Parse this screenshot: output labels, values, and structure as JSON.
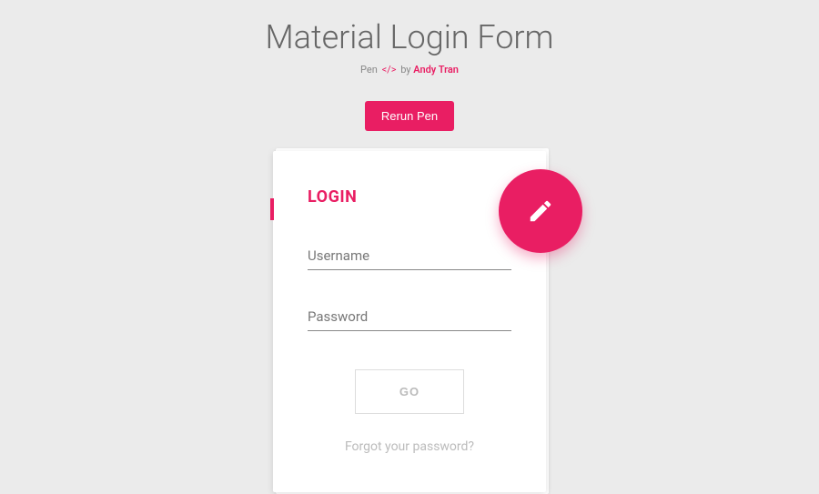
{
  "header": {
    "title": "Material Login Form",
    "subtitle_prefix": "Pen",
    "subtitle_middle": "by",
    "author": "Andy Tran",
    "rerun_label": "Rerun Pen"
  },
  "card": {
    "title": "LOGIN",
    "username_label": "Username",
    "password_label": "Password",
    "submit_label": "GO",
    "forgot_label": "Forgot your password?"
  },
  "colors": {
    "accent": "#e91e63",
    "background": "#ebebeb"
  }
}
